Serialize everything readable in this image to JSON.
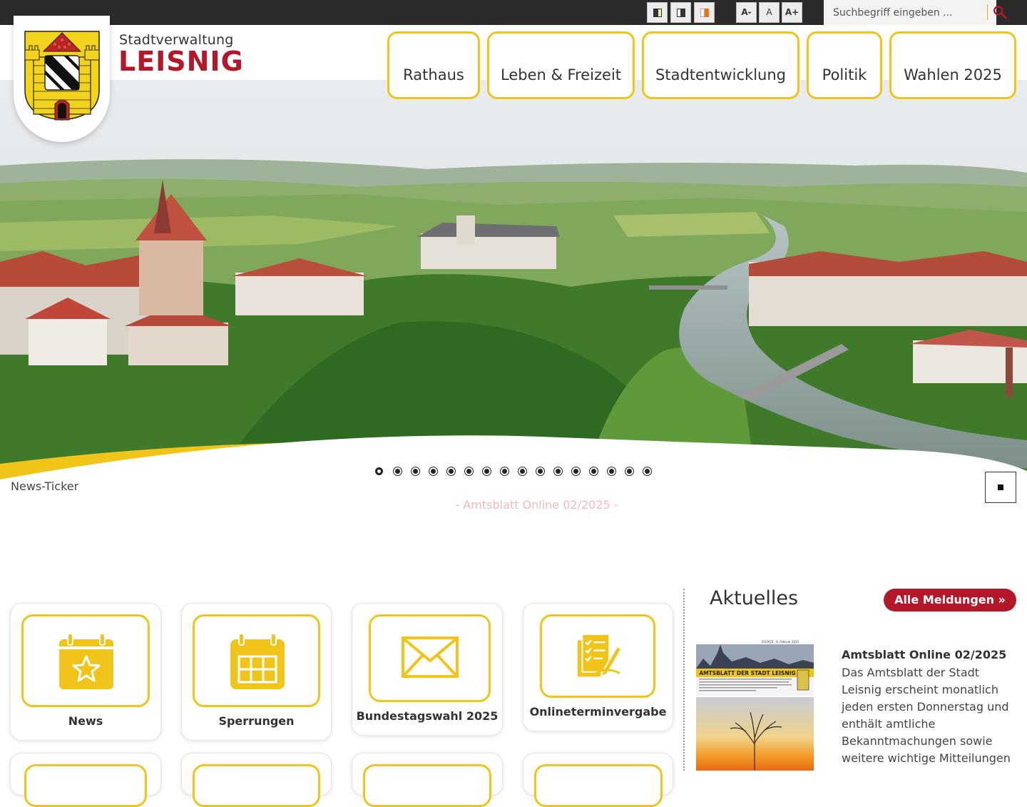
{
  "topbar": {
    "contrast_buttons": [
      "contrast-default",
      "contrast-high",
      "contrast-color"
    ],
    "font_buttons": {
      "smaller": "A-",
      "normal": "A",
      "larger": "A+"
    },
    "search": {
      "placeholder": "Suchbegriff eingeben ...",
      "icon": "search-icon"
    }
  },
  "logo": {
    "small": "Stadtverwaltung",
    "big": "LEISNIG",
    "crest_icon": "coat-of-arms-icon"
  },
  "nav": {
    "items": [
      {
        "label": "Rathaus"
      },
      {
        "label": "Leben & Freizeit"
      },
      {
        "label": "Stadtentwicklung"
      },
      {
        "label": "Politik"
      },
      {
        "label": "Wahlen 2025"
      }
    ]
  },
  "hero": {
    "slide_count": 16,
    "active_slide": 1
  },
  "ticker": {
    "label": "News-Ticker",
    "text": "- Amtsblatt Online 02/2025 -"
  },
  "tiles": [
    {
      "label": "News",
      "icon": "calendar-star-icon"
    },
    {
      "label": "Sperrungen",
      "icon": "calendar-grid-icon"
    },
    {
      "label": "Bundestagswahl 2025",
      "icon": "envelope-icon"
    },
    {
      "label": "Onlineterminvergabe",
      "icon": "form-checklist-icon"
    }
  ],
  "aktuelles": {
    "title": "Aktuelles",
    "all_button": "Alle Meldungen »",
    "news": [
      {
        "title": "Amtsblatt Online 02/2025",
        "text": "Das Amtsblatt der Stadt Leisnig erscheint monatlich jeden ersten Donnerstag und enthält amtliche Bekanntmachungen sowie weitere wichtige Mitteilungen",
        "thumb_header": "AMTSBLATT DER STADT LEISNIG",
        "thumb_date": "02/2025 · 6. Februar 2025"
      }
    ]
  },
  "colors": {
    "accent_yellow": "#f0c419",
    "brand_red": "#b5172a",
    "topbar": "#2b2b2b"
  }
}
